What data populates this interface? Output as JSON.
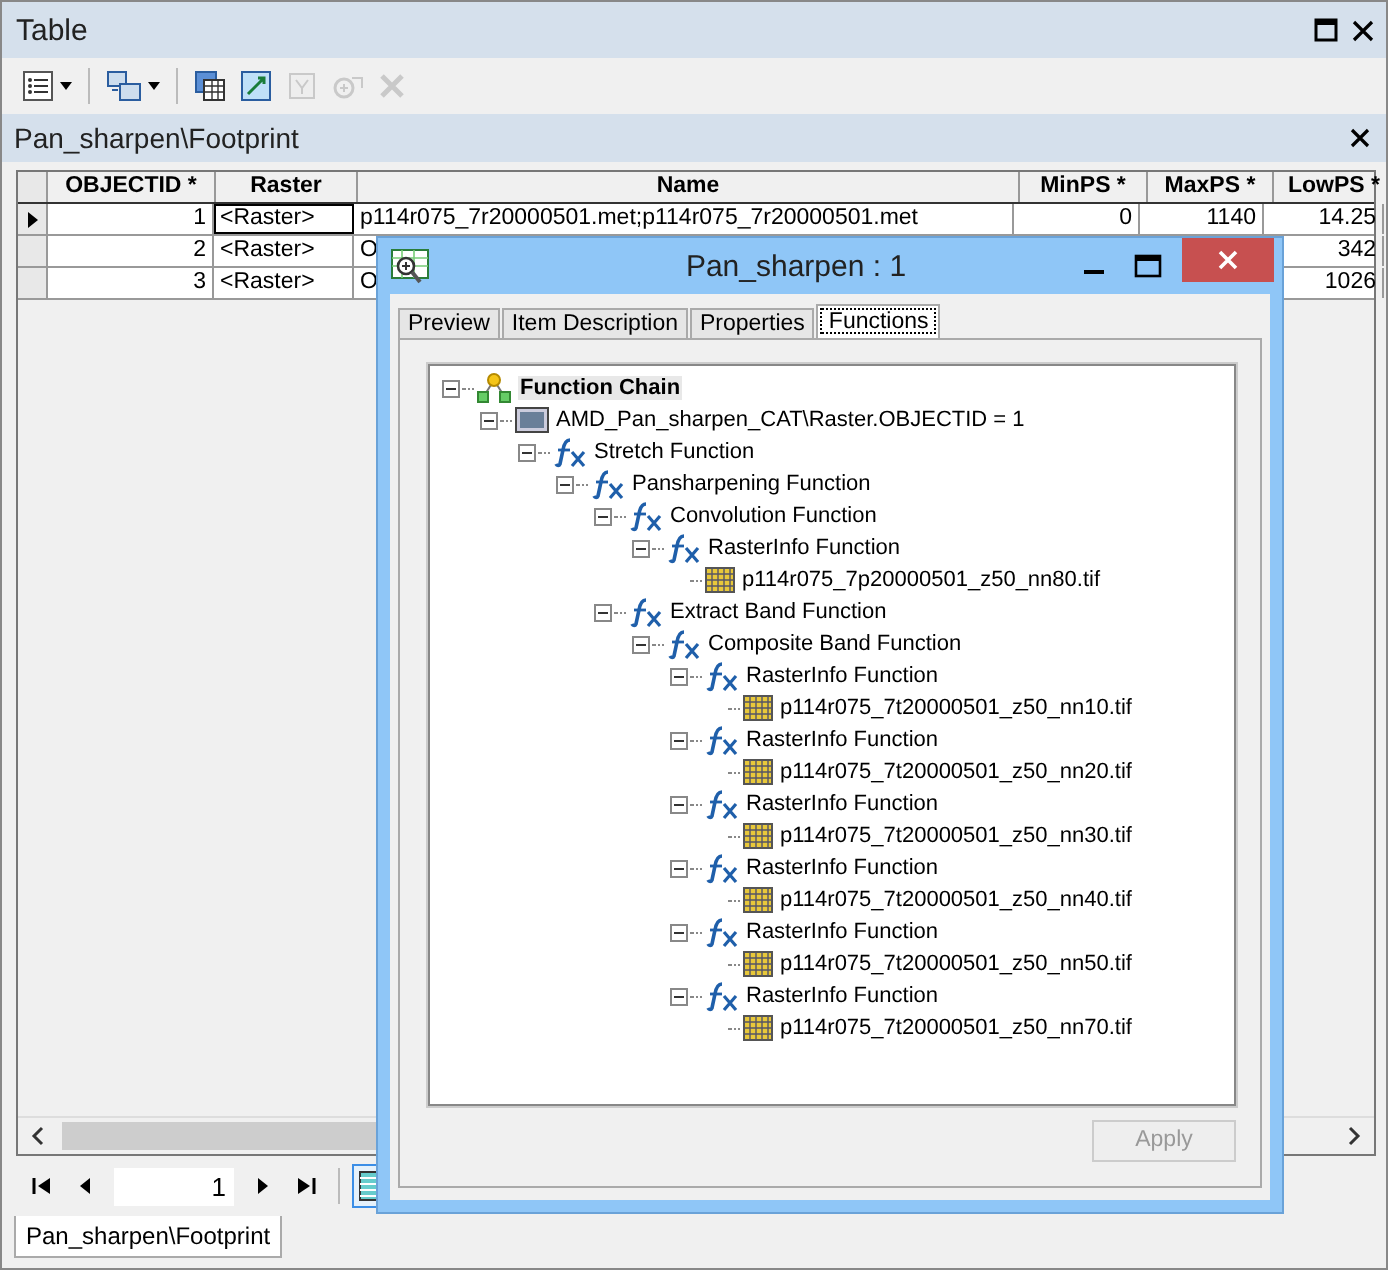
{
  "window": {
    "title": "Table"
  },
  "toolbar": [
    {
      "kind": "options",
      "dropdown": true,
      "disabled": false
    },
    {
      "kind": "related",
      "dropdown": true,
      "disabled": false
    },
    {
      "kind": "select-attr",
      "dropdown": false,
      "disabled": false
    },
    {
      "kind": "switch",
      "dropdown": false,
      "disabled": false
    },
    {
      "kind": "clear",
      "dropdown": false,
      "disabled": true
    },
    {
      "kind": "zoom",
      "dropdown": false,
      "disabled": true
    },
    {
      "kind": "delete",
      "dropdown": false,
      "disabled": true
    }
  ],
  "table_panel": {
    "title": "Pan_sharpen\\Footprint"
  },
  "table": {
    "columns": [
      "OBJECTID *",
      "Raster",
      "Name",
      "MinPS *",
      "MaxPS *",
      "LowPS *"
    ],
    "rows": [
      {
        "current": true,
        "cells": [
          "1",
          "<Raster>",
          "p114r075_7r20000501.met;p114r075_7r20000501.met",
          "0",
          "1140",
          "14.25"
        ]
      },
      {
        "current": false,
        "cells": [
          "2",
          "<Raster>",
          "O",
          null,
          null,
          "342"
        ]
      },
      {
        "current": false,
        "cells": [
          "3",
          "<Raster>",
          "O",
          null,
          null,
          "1026"
        ]
      }
    ]
  },
  "navigator": {
    "record": "1",
    "show_all_selected": true
  },
  "bottom_tabs": [
    {
      "label": "Pan_sharpen\\Footprint",
      "selected": true
    }
  ],
  "dialog": {
    "title": "Pan_sharpen : 1",
    "tabs": [
      {
        "label": "Preview",
        "selected": false
      },
      {
        "label": "Item Description",
        "selected": false
      },
      {
        "label": "Properties",
        "selected": false
      },
      {
        "label": "Functions",
        "selected": true
      }
    ],
    "tree": [
      {
        "kind": "chain",
        "label": "Function Chain",
        "selected": true,
        "expanded": true,
        "children": [
          {
            "kind": "dataset",
            "label": "AMD_Pan_sharpen_CAT\\Raster.OBJECTID = 1",
            "selected": false,
            "expanded": true,
            "children": [
              {
                "kind": "function",
                "label": "Stretch Function",
                "selected": false,
                "expanded": true,
                "children": [
                  {
                    "kind": "function",
                    "label": "Pansharpening Function",
                    "selected": false,
                    "expanded": true,
                    "children": [
                      {
                        "kind": "function",
                        "label": "Convolution Function",
                        "selected": false,
                        "expanded": true,
                        "children": [
                          {
                            "kind": "function",
                            "label": "RasterInfo Function",
                            "selected": false,
                            "expanded": true,
                            "children": [
                              {
                                "kind": "file",
                                "label": "p114r075_7p20000501_z50_nn80.tif",
                                "selected": false
                              }
                            ]
                          }
                        ]
                      },
                      {
                        "kind": "function",
                        "label": "Extract Band Function",
                        "selected": false,
                        "expanded": true,
                        "children": [
                          {
                            "kind": "function",
                            "label": "Composite Band Function",
                            "selected": false,
                            "expanded": true,
                            "children": [
                              {
                                "kind": "function",
                                "label": "RasterInfo Function",
                                "selected": false,
                                "expanded": true,
                                "children": [
                                  {
                                    "kind": "file",
                                    "label": "p114r075_7t20000501_z50_nn10.tif",
                                    "selected": false
                                  }
                                ]
                              },
                              {
                                "kind": "function",
                                "label": "RasterInfo Function",
                                "selected": false,
                                "expanded": true,
                                "children": [
                                  {
                                    "kind": "file",
                                    "label": "p114r075_7t20000501_z50_nn20.tif",
                                    "selected": false
                                  }
                                ]
                              },
                              {
                                "kind": "function",
                                "label": "RasterInfo Function",
                                "selected": false,
                                "expanded": true,
                                "children": [
                                  {
                                    "kind": "file",
                                    "label": "p114r075_7t20000501_z50_nn30.tif",
                                    "selected": false
                                  }
                                ]
                              },
                              {
                                "kind": "function",
                                "label": "RasterInfo Function",
                                "selected": false,
                                "expanded": true,
                                "children": [
                                  {
                                    "kind": "file",
                                    "label": "p114r075_7t20000501_z50_nn40.tif",
                                    "selected": false
                                  }
                                ]
                              },
                              {
                                "kind": "function",
                                "label": "RasterInfo Function",
                                "selected": false,
                                "expanded": true,
                                "children": [
                                  {
                                    "kind": "file",
                                    "label": "p114r075_7t20000501_z50_nn50.tif",
                                    "selected": false
                                  }
                                ]
                              },
                              {
                                "kind": "function",
                                "label": "RasterInfo Function",
                                "selected": false,
                                "expanded": true,
                                "children": [
                                  {
                                    "kind": "file",
                                    "label": "p114r075_7t20000501_z50_nn70.tif",
                                    "selected": false
                                  }
                                ]
                              }
                            ]
                          }
                        ]
                      }
                    ]
                  }
                ]
              }
            ]
          }
        ]
      }
    ],
    "apply_button": {
      "label": "Apply",
      "disabled": true
    }
  }
}
